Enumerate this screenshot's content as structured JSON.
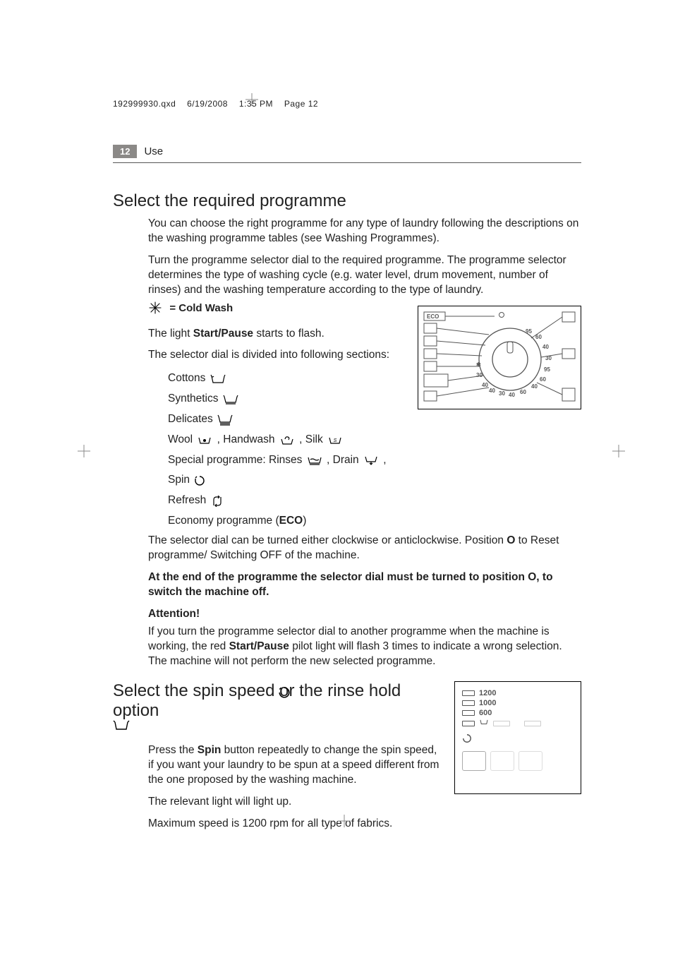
{
  "meta": {
    "file": "192999930.qxd",
    "date": "6/19/2008",
    "time": "1:35 PM",
    "pg": "Page 12"
  },
  "header": {
    "page_no": "12",
    "section": "Use"
  },
  "h2a": "Select the required programme",
  "p1": "You can choose the right programme for any type of laundry following the descriptions on the washing programme tables (see Washing Programmes).",
  "p2": "Turn the programme selector dial to the required programme. The programme selector determines the type of washing cycle (e.g. water level, drum movement, number of rinses) and the washing temperature according to the type of laundry.",
  "cold": "= Cold Wash",
  "p3a": "The light ",
  "p3b": "Start/Pause",
  "p3c": " starts to flash.",
  "p4": "The selector dial is divided into following sections:",
  "list": {
    "cottons": "Cottons",
    "synth": "Synthetics",
    "del": "Delicates",
    "woola": "Wool",
    "woolb": ", Handwash",
    "woolc": ", Silk",
    "speca": "Special programme: Rinses",
    "specb": ", Drain",
    "specc": ", Spin",
    "refresh": "Refresh",
    "eco_a": "Economy programme (",
    "eco_b": "ECO",
    "eco_c": ")"
  },
  "p5a": "The selector dial can be turned either clockwise or anticlockwise. Position ",
  "p5b": "O",
  "p5c": " to Reset programme/ Switching OFF of the machine.",
  "p6": "At the end of the programme the selector dial must be turned to position O, to switch the machine off.",
  "p7": "Attention!",
  "p8a": "If you turn the programme selector dial to another programme when the machine is working, the red ",
  "p8b": "Start/Pause",
  "p8c": " pilot light will flash 3 times to indicate a wrong selection. The machine will not perform the new selected programme.",
  "h2b": "Select the spin speed      or the rinse hold option",
  "p9a": "Press the ",
  "p9b": "Spin",
  "p9c": " button repeatedly to change the spin speed, if you want your laundry to be spun at a speed different from the one proposed by the washing machine.",
  "p10": "The relevant light will light up.",
  "p11": "Maximum speed is 1200 rpm for all type of fabrics.",
  "dial": {
    "eco": "ECO",
    "nums": [
      "95",
      "60",
      "40",
      "30",
      "95",
      "60",
      "40",
      "30",
      "60",
      "40",
      "40",
      "30",
      "40"
    ]
  },
  "spinpanel": {
    "v1": "1200",
    "v2": "1000",
    "v3": "600"
  }
}
